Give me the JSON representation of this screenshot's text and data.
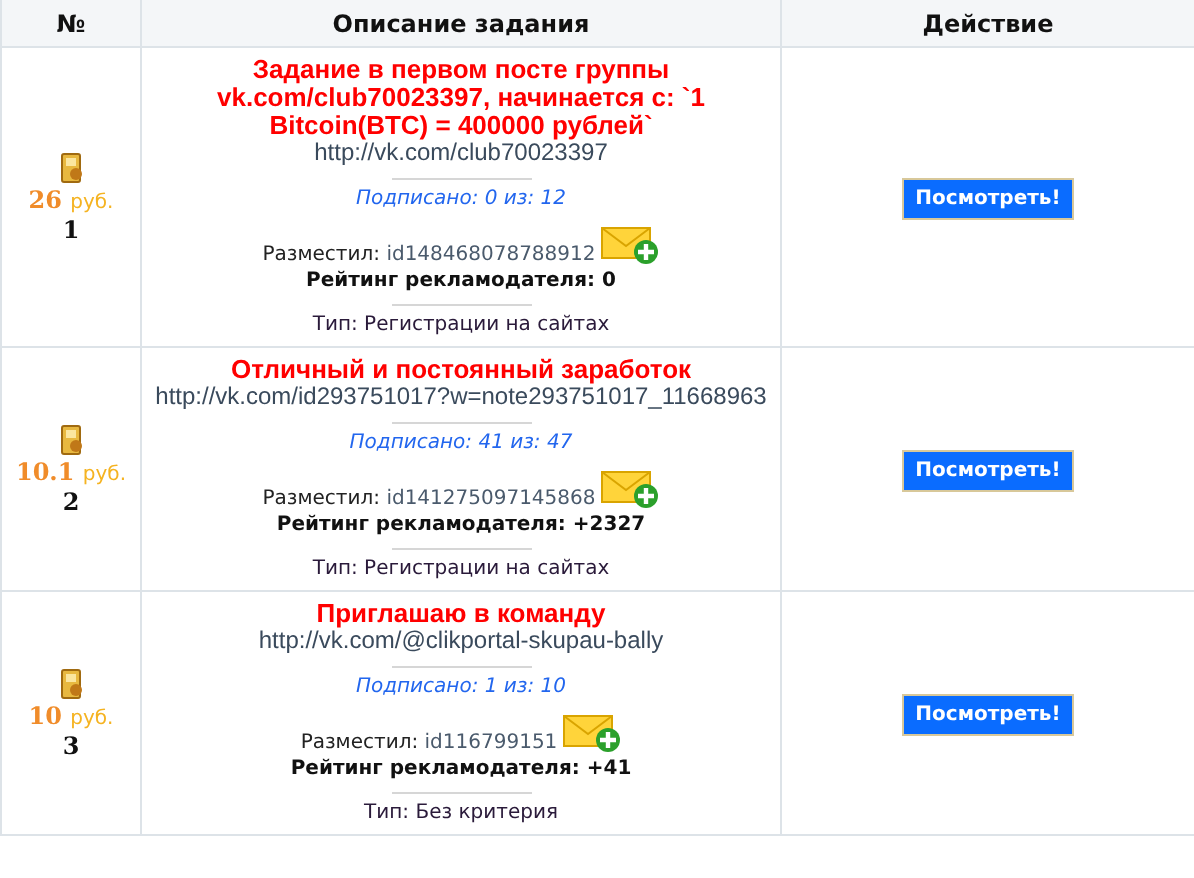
{
  "table": {
    "columns": [
      "№",
      "Описание задания",
      "Действие"
    ],
    "rows": [
      {
        "amount": "26",
        "currency": "руб.",
        "number": "1",
        "title": "Задание в первом посте группы vk.com/club70023397, начинается с: `1 Bitcoin(BTC) = 400000 рублей`",
        "url": "http://vk.com/club70023397",
        "signed": "Подписано: 0 из: 12",
        "placed_label": "Разместил:",
        "placed_id": "id148468078788912",
        "rating": "Рейтинг рекламодателя: 0",
        "type": "Тип: Регистрации на сайтах",
        "action": "Посмотреть!"
      },
      {
        "amount": "10.1",
        "currency": "руб.",
        "number": "2",
        "title": "Отличный и постоянный заработок",
        "url": "http://vk.com/id293751017?w=note293751017_11668963",
        "signed": "Подписано: 41 из: 47",
        "placed_label": "Разместил:",
        "placed_id": "id141275097145868",
        "rating": "Рейтинг рекламодателя: +2327",
        "type": "Тип: Регистрации на сайтах",
        "action": "Посмотреть!"
      },
      {
        "amount": "10",
        "currency": "руб.",
        "number": "3",
        "title": "Приглашаю в команду",
        "url": "http://vk.com/@clikportal-skupau-bally",
        "signed": "Подписано: 1 из: 10",
        "placed_label": "Разместил:",
        "placed_id": "id116799151",
        "rating": "Рейтинг рекламодателя: +41",
        "type": "Тип: Без критерия",
        "action": "Посмотреть!"
      }
    ]
  }
}
